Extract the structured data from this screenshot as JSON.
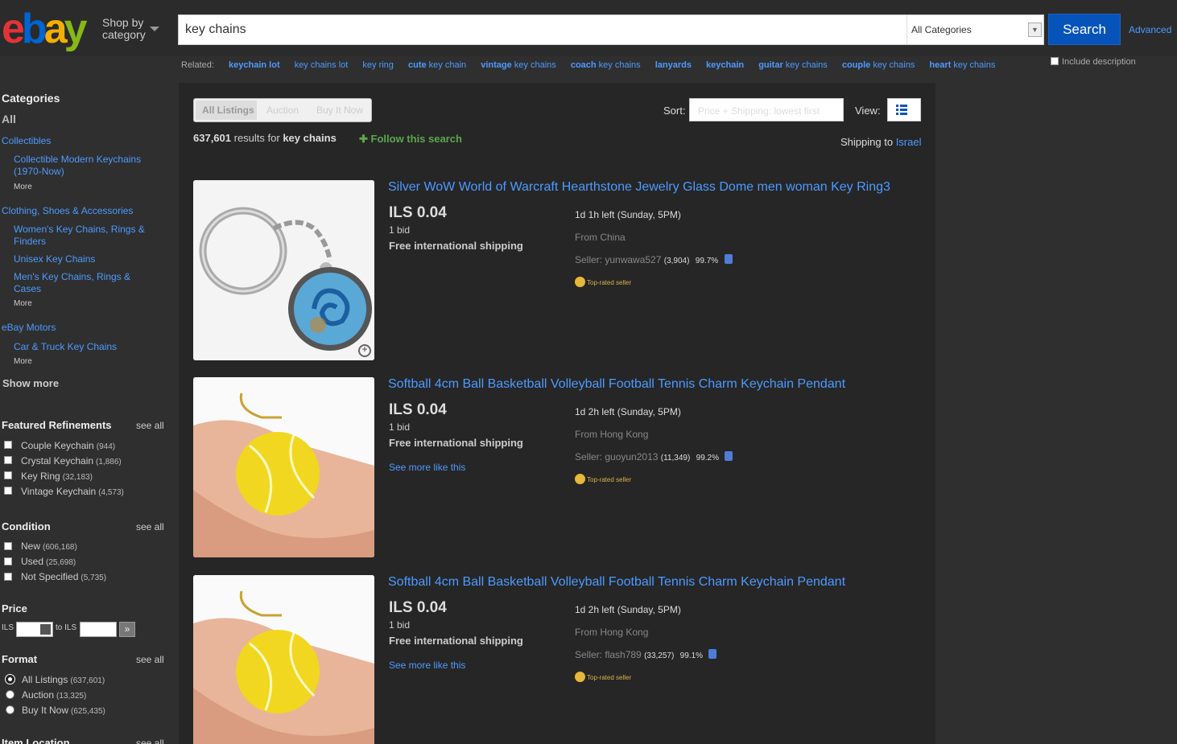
{
  "header": {
    "logo": "ebay",
    "shop_by_category": [
      "Shop by",
      "category"
    ],
    "search_value": "key chains",
    "category_select": "All Categories",
    "search_button": "Search",
    "advanced_link": "Advanced",
    "include_description": "Include description"
  },
  "related": {
    "label": "Related:",
    "links": [
      {
        "bold": "keychain lot",
        "rest": ""
      },
      {
        "bold": "",
        "rest": "key chains lot"
      },
      {
        "bold": "",
        "rest": "key ring"
      },
      {
        "bold": "cute",
        "rest": " key chain"
      },
      {
        "bold": "vintage",
        "rest": " key chains"
      },
      {
        "bold": "coach",
        "rest": " key chains"
      },
      {
        "bold": "lanyards",
        "rest": ""
      },
      {
        "bold": "keychain",
        "rest": ""
      },
      {
        "bold": "guitar",
        "rest": " key chains"
      },
      {
        "bold": "couple",
        "rest": " key chains"
      },
      {
        "bold": "heart",
        "rest": " key chains"
      }
    ]
  },
  "sidebar": {
    "categories_heading": "Categories",
    "all": "All",
    "cat1": "Collectibles",
    "cat1_sub1": "Collectible Modern Keychains (1970-Now)",
    "more1": "More",
    "cat2": "Clothing, Shoes & Accessories",
    "cat2_sub1": "Women's Key Chains, Rings & Finders",
    "cat2_sub2": "Unisex Key Chains",
    "cat2_sub3": "Men's Key Chains, Rings & Cases",
    "more2": "More",
    "cat3": "eBay Motors",
    "cat3_sub1": "Car & Truck Key Chains",
    "more3": "More",
    "show_more": "Show more",
    "see_all": "see all",
    "featured_heading": "Featured Refinements",
    "featured": [
      {
        "label": "Couple Keychain",
        "count": "(944)"
      },
      {
        "label": "Crystal Keychain",
        "count": "(1,886)"
      },
      {
        "label": "Key Ring",
        "count": "(32,183)"
      },
      {
        "label": "Vintage Keychain",
        "count": "(4,573)"
      }
    ],
    "condition_heading": "Condition",
    "condition": [
      {
        "label": "New",
        "count": "(606,168)"
      },
      {
        "label": "Used",
        "count": "(25,698)"
      },
      {
        "label": "Not Specified",
        "count": "(5,735)"
      }
    ],
    "price_heading": "Price",
    "price_from": "ILS",
    "price_to": "to ILS",
    "format_heading": "Format",
    "format": [
      {
        "label": "All Listings",
        "count": "(637,601)"
      },
      {
        "label": "Auction",
        "count": "(13,325)"
      },
      {
        "label": "Buy It Now",
        "count": "(625,435)"
      }
    ],
    "format_selected": 0,
    "item_location_heading": "Item Location"
  },
  "main": {
    "tabs": [
      "All Listings",
      "Auction",
      "Buy It Now"
    ],
    "sort_label": "Sort:",
    "sort_value": "Price + Shipping: lowest first",
    "view_label": "View:",
    "results_count": "637,601",
    "results_for": "results for",
    "query": "key chains",
    "follow": "Follow this search",
    "shipping_to": "Shipping to",
    "shipping_country": "Israel"
  },
  "listings": [
    {
      "title": "Silver WoW World of Warcraft Hearthstone Jewelry Glass Dome men woman Key Ring3",
      "price": "ILS 0.04",
      "bids": "1 bid",
      "shipping": "Free international shipping",
      "see_more": "",
      "time_left": "1d 1h left (Sunday, 5PM)",
      "from": "From China",
      "seller_label": "Seller:",
      "seller": "yunwawa527",
      "feedback": "(3,904)",
      "percent": "99.7%",
      "top_rated": "Top-rated seller"
    },
    {
      "title": "Softball 4cm Ball Basketball Volleyball Football Tennis Charm Keychain Pendant",
      "price": "ILS 0.04",
      "bids": "1 bid",
      "shipping": "Free international shipping",
      "see_more": "See more like this",
      "time_left": "1d 2h left (Sunday, 5PM)",
      "from": "From Hong Kong",
      "seller_label": "Seller:",
      "seller": "guoyun2013",
      "feedback": "(11,349)",
      "percent": "99.2%",
      "top_rated": "Top-rated seller"
    },
    {
      "title": "Softball 4cm Ball Basketball Volleyball Football Tennis Charm Keychain Pendant",
      "price": "ILS 0.04",
      "bids": "1 bid",
      "shipping": "Free international shipping",
      "see_more": "See more like this",
      "time_left": "1d 2h left (Sunday, 5PM)",
      "from": "From Hong Kong",
      "seller_label": "Seller:",
      "seller": "flash789",
      "feedback": "(33,257)",
      "percent": "99.1%",
      "top_rated": "Top-rated seller"
    }
  ]
}
